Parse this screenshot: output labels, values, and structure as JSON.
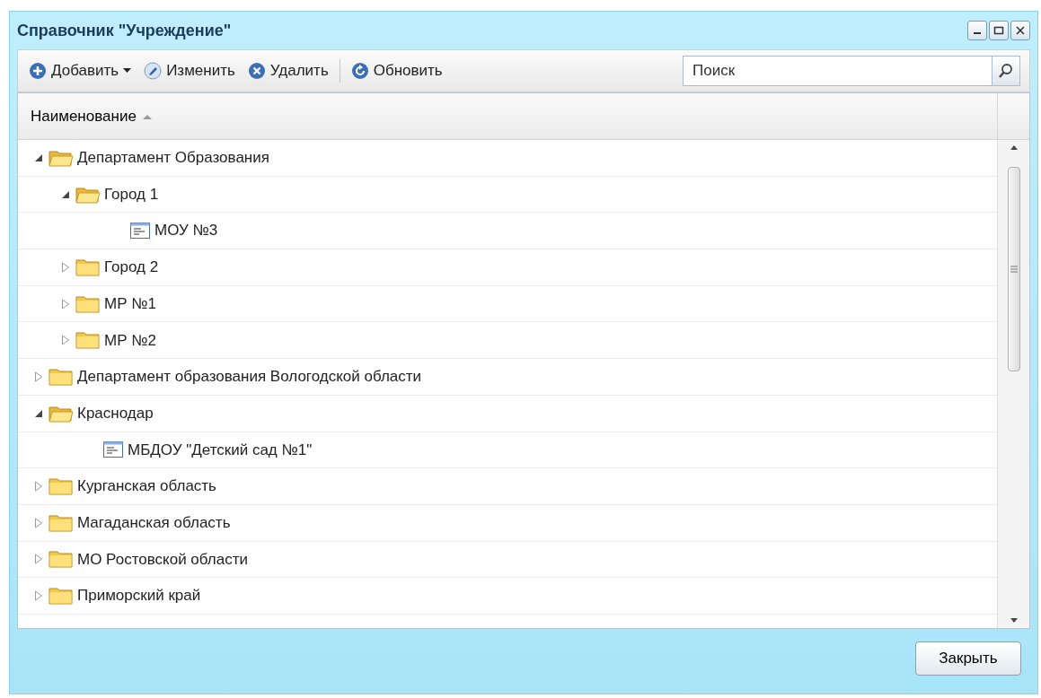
{
  "window": {
    "title": "Справочник \"Учреждение\""
  },
  "toolbar": {
    "buttons": [
      {
        "label": "Добавить",
        "kind": "add",
        "dropdown": true
      },
      {
        "label": "Изменить",
        "kind": "edit",
        "dropdown": false
      },
      {
        "label": "Удалить",
        "kind": "delete",
        "dropdown": false
      },
      {
        "label": "Обновить",
        "kind": "refresh",
        "dropdown": false
      }
    ],
    "search": {
      "placeholder": "Поиск"
    }
  },
  "table": {
    "columns": [
      {
        "label": "Наименование",
        "sort_ascending": true
      }
    ],
    "rows": [
      {
        "label": "Департамент Образования",
        "kind": "folder",
        "expanded": true,
        "children": [
          {
            "label": "Город 1",
            "kind": "folder",
            "expanded": true,
            "children": [
              {
                "label": "МОУ №3",
                "kind": "record"
              }
            ]
          },
          {
            "label": "Город 2",
            "kind": "folder",
            "expanded": false
          },
          {
            "label": "МР №1",
            "kind": "folder",
            "expanded": false
          },
          {
            "label": "МР №2",
            "kind": "folder",
            "expanded": false
          }
        ]
      },
      {
        "label": "Департамент образования Вологодской области",
        "kind": "folder",
        "expanded": false
      },
      {
        "label": "Краснодар",
        "kind": "folder",
        "expanded": true,
        "children": [
          {
            "label": "МБДОУ \"Детский сад №1\"",
            "kind": "record"
          }
        ]
      },
      {
        "label": "Курганская область",
        "kind": "folder",
        "expanded": false
      },
      {
        "label": "Магаданская область",
        "kind": "folder",
        "expanded": false
      },
      {
        "label": "МО Ростовской области",
        "kind": "folder",
        "expanded": false
      },
      {
        "label": "Приморский край",
        "kind": "folder",
        "expanded": false
      }
    ]
  },
  "footer": {
    "buttons": [
      "Закрыть"
    ]
  }
}
